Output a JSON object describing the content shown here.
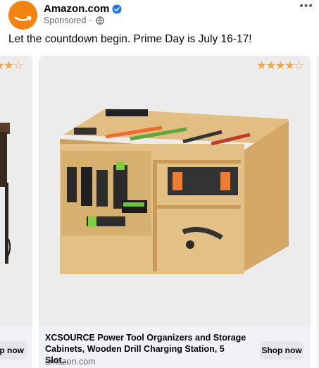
{
  "post": {
    "page_name": "Amazon.com",
    "sponsored_label": "Sponsored",
    "separator": "·",
    "more_label": "•••",
    "caption": "Let the countdown begin. Prime Day is July 16-17!"
  },
  "carousel": {
    "cards": [
      {
        "rating": 4.5,
        "shop_button": "Shop now"
      },
      {
        "rating": 4.5,
        "title": "XCSOURCE Power Tool Organizers and Storage Cabinets, Wooden Drill Charging Station, 5 Slot...",
        "domain": "amazon.com",
        "shop_button": "Shop now"
      }
    ],
    "left_partial_button": "p now"
  },
  "colors": {
    "brand": "#f3820f",
    "verified": "#1877f2",
    "star": "#f2a93b",
    "wood": "#dcb575"
  },
  "icons": [
    "amazon-logo",
    "verified-badge-icon",
    "globe-icon",
    "more-options-icon",
    "star-icon"
  ]
}
